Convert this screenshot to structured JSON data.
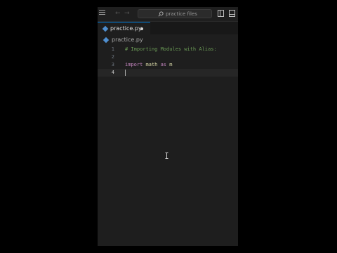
{
  "titlebar": {
    "search_text": "practice files"
  },
  "tab": {
    "label": "practice.py"
  },
  "breadcrumb": {
    "file": "practice.py"
  },
  "editor": {
    "lines": [
      {
        "number": "1",
        "comment": "# Importing Modules with Alias:"
      },
      {
        "number": "2"
      },
      {
        "number": "3",
        "kw1": "import",
        "name": "math",
        "kw2": "as",
        "alias": "m"
      },
      {
        "number": "4"
      }
    ],
    "current_line": "4"
  },
  "colors": {
    "accent": "#0078d4",
    "comment": "#6a9955",
    "keyword": "#c586c0",
    "identifier": "#dcdcaa",
    "python_icon": "#4f8fd0"
  },
  "icons": [
    "menu-icon",
    "back-arrow-icon",
    "forward-arrow-icon",
    "search-icon",
    "python-file-icon",
    "toggle-primary-sidebar-icon",
    "toggle-panel-icon",
    "text-cursor-icon"
  ]
}
